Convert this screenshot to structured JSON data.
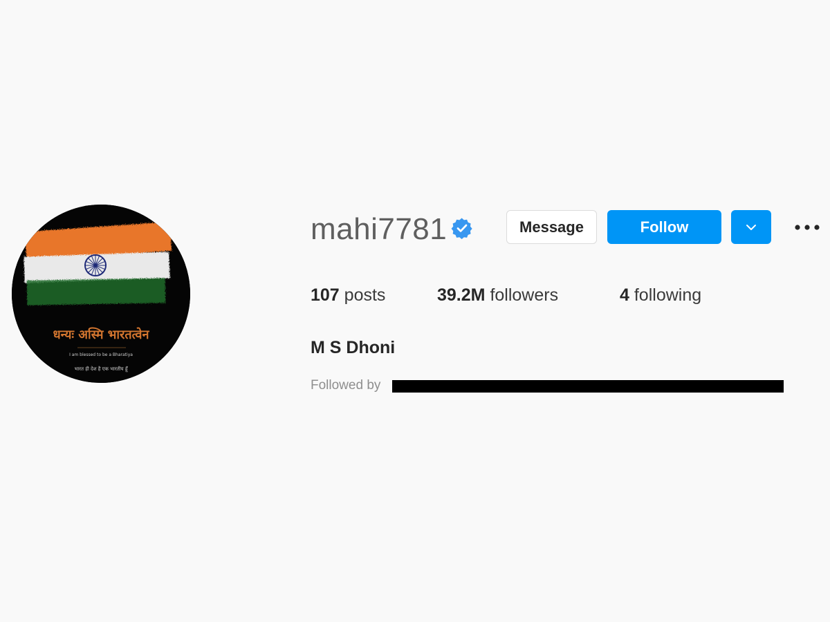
{
  "profile": {
    "username": "mahi7781",
    "verified": true,
    "full_name": "M S Dhoni",
    "avatar": {
      "title_text": "धन्यः अस्मि भारतत्वेन",
      "subtitle_text": "I am blessed to be a Bharatiya",
      "hindi_text": "भारत ही देश है एक भारतीय हूँ"
    }
  },
  "actions": {
    "message_label": "Message",
    "follow_label": "Follow",
    "dropdown_icon": "chevron-down-icon",
    "more_icon": "more-options-icon"
  },
  "stats": {
    "posts": {
      "value": "107",
      "label": "posts"
    },
    "followers": {
      "value": "39.2M",
      "label": "followers"
    },
    "following": {
      "value": "4",
      "label": "following"
    }
  },
  "followed_by_label": "Followed by",
  "colors": {
    "background": "#f9f9f9",
    "primary_blue": "#0095f6",
    "verified_blue": "#3897f0",
    "text_primary": "#262626",
    "text_secondary": "#8e8e8e",
    "redaction": "#000000"
  }
}
